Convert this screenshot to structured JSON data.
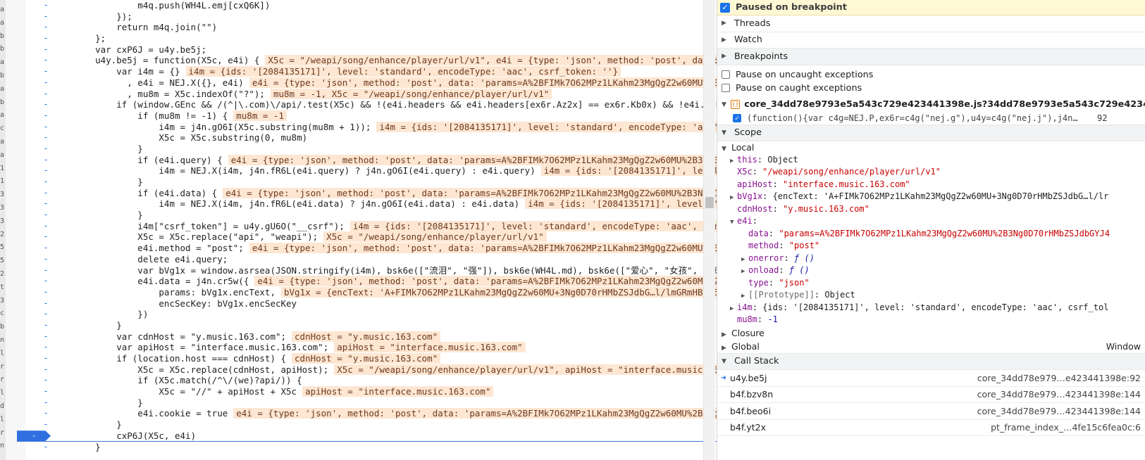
{
  "left_strip_chars": [
    "a",
    "a",
    "b",
    "b",
    "a",
    "b",
    "a",
    "b",
    "a",
    "c",
    "a",
    "a",
    "1",
    "1",
    "3",
    "3",
    "3",
    "2",
    "5",
    "5",
    "2",
    "t",
    "3",
    "c",
    "b",
    "n",
    "l",
    "r",
    "r",
    "l",
    "d",
    "l",
    "r",
    "n"
  ],
  "code_lines": [
    {
      "code": "            m4q.push(WH4L.emj[cxQ6K])",
      "inline": ""
    },
    {
      "code": "        });",
      "inline": ""
    },
    {
      "code": "        return m4q.join(\"\")",
      "inline": ""
    },
    {
      "code": "    };",
      "inline": ""
    },
    {
      "code": "    var cxP6J = u4y.be5j;",
      "inline": ""
    },
    {
      "code": "    u4y.be5j = function(X5c, e4i) {",
      "inline": "X5c = \"/weapi/song/enhance/player/url/v1\", e4i = {type: 'json', method: 'post', data: 'params"
    },
    {
      "code": "        var i4m = {}",
      "inline": "i4m = {ids: '[2084135171]', level: 'standard', encodeType: 'aac', csrf_token: ''}"
    },
    {
      "code": "          , e4i = NEJ.X({}, e4i)",
      "inline": "e4i = {type: 'json', method: 'post', data: 'params=A%2BFIMk7O62MPz1LKahm23MgQgZ2w60MU%2B3Ng0D7…"
    },
    {
      "code": "          , mu8m = X5c.indexOf(\"?\");",
      "inline": "mu8m = -1, X5c = \"/weapi/song/enhance/player/url/v1\""
    },
    {
      "code": "        if (window.GEnc && /(^|\\.com)\\/api/.test(X5c) && !(e4i.headers && e4i.headers[ex6r.Az2x] == ex6r.Kb0x) && !e4i.noEnc) {",
      "inline": ""
    },
    {
      "code": "            if (mu8m != -1) {",
      "inline": "mu8m = -1"
    },
    {
      "code": "                i4m = j4n.gO6I(X5c.substring(mu8m + 1));",
      "inline": "i4m = {ids: '[2084135171]', level: 'standard', encodeType: 'aac', csrf_"
    },
    {
      "code": "                X5c = X5c.substring(0, mu8m)",
      "inline": ""
    },
    {
      "code": "            }",
      "inline": ""
    },
    {
      "code": "            if (e4i.query) {",
      "inline": "e4i = {type: 'json', method: 'post', data: 'params=A%2BFIMk7O62MPz1LKahm23MgQgZ2w60MU%2B3Ng0D7…85d6"
    },
    {
      "code": "                i4m = NEJ.X(i4m, j4n.fR6L(e4i.query) ? j4n.gO6I(e4i.query) : e4i.query)",
      "inline": "i4m = {ids: '[2084135171]', level: 'stan"
    },
    {
      "code": "            }",
      "inline": ""
    },
    {
      "code": "            if (e4i.data) {",
      "inline": "e4i = {type: 'json', method: 'post', data: 'params=A%2BFIMk7O62MPz1LKahm23MgQgZ2w60MU%2B3Ng0D7…85d6a"
    },
    {
      "code": "                i4m = NEJ.X(i4m, j4n.fR6L(e4i.data) ? j4n.gO6I(e4i.data) : e4i.data)",
      "inline": "i4m = {ids: '[2084135171]', level: 'standar"
    },
    {
      "code": "            }",
      "inline": ""
    },
    {
      "code": "            i4m[\"csrf_token\"] = u4y.gU6O(\"__csrf\");",
      "inline": "i4m = {ids: '[2084135171]', level: 'standard', encodeType: 'aac', csrf_token"
    },
    {
      "code": "            X5c = X5c.replace(\"api\", \"weapi\");",
      "inline": "X5c = \"/weapi/song/enhance/player/url/v1\""
    },
    {
      "code": "            e4i.method = \"post\";",
      "inline": "e4i = {type: 'json', method: 'post', data: 'params=A%2BFIMk7O62MPz1LKahm23MgQgZ2w60MU%2B3Ng0D7…"
    },
    {
      "code": "            delete e4i.query;",
      "inline": ""
    },
    {
      "code": "            var bVg1x = window.asrsea(JSON.stringify(i4m), bsk6e([\"流泪\", \"强\"]), bsk6e(WH4L.md), bsk6e([\"爱心\", \"女孩\", \"惊恐\", \"",
      "inline": ""
    },
    {
      "code": "            e4i.data = j4n.cr5w({",
      "inline": "e4i = {type: 'json', method: 'post', data: 'params=A%2BFIMk7O62MPz1LKahm23MgQgZ2w60MU%2B3Ng0D7"
    },
    {
      "code": "                params: bVg1x.encText,",
      "inline": "bVg1x = {encText: 'A+FIMk7O62MPz1LKahm23MgQgZ2w60MU+3Ng0D70rHMbZSJdbG…l/lmGRmHB875iqdjIzZ"
    },
    {
      "code": "                encSecKey: bVg1x.encSecKey",
      "inline": ""
    },
    {
      "code": "            })",
      "inline": ""
    },
    {
      "code": "        }",
      "inline": ""
    },
    {
      "code": "        var cdnHost = \"y.music.163.com\";",
      "inline": "cdnHost = \"y.music.163.com\""
    },
    {
      "code": "        var apiHost = \"interface.music.163.com\";",
      "inline": "apiHost = \"interface.music.163.com\""
    },
    {
      "code": "        if (location.host === cdnHost) {",
      "inline": "cdnHost = \"y.music.163.com\""
    },
    {
      "code": "            X5c = X5c.replace(cdnHost, apiHost);",
      "inline": "X5c = \"/weapi/song/enhance/player/url/v1\", apiHost = \"interface.music.163.com\""
    },
    {
      "code": "            if (X5c.match(/^\\/(we)?api/)) {",
      "inline": ""
    },
    {
      "code": "                X5c = \"//\" + apiHost + X5c",
      "inline": "apiHost = \"interface.music.163.com\""
    },
    {
      "code": "            }",
      "inline": ""
    },
    {
      "code": "            e4i.cookie = true",
      "inline": "e4i = {type: 'json', method: 'post', data: 'params=A%2BFIMk7O62MPz1LKahm23MgQgZ2w60MU%2B3Ng0D7…85c"
    },
    {
      "code": "        }",
      "inline": ""
    },
    {
      "code": "        cxP6J(X5c, e4i)",
      "inline": ""
    },
    {
      "code": "    }",
      "inline": ""
    }
  ],
  "gutter_dash": "-",
  "panel": {
    "paused_text": "Paused on breakpoint",
    "threads": "Threads",
    "watch": "Watch",
    "breakpoints": "Breakpoints",
    "pause_uncaught": "Pause on uncaught exceptions",
    "pause_caught": "Pause on caught exceptions",
    "bp_file": "core_34dd78e9793e5a543c729e423441398e.js?34dd78e9793e5a543c729e423441…",
    "bp_snippet": "(function(){var c4g=NEJ.P,ex6r=c4g(\"nej.g\"),u4y=c4g(\"nej.j\"),j4n…",
    "bp_line": "92",
    "scope": "Scope",
    "local": "Local",
    "scope_items": [
      {
        "indent": 1,
        "arrow": "▶",
        "key": "this",
        "sep": ": ",
        "val": "Object",
        "vtype": "plain"
      },
      {
        "indent": 1,
        "arrow": "",
        "key": "X5c",
        "sep": ": ",
        "val": "\"/weapi/song/enhance/player/url/v1\"",
        "vtype": "str"
      },
      {
        "indent": 1,
        "arrow": "",
        "key": "apiHost",
        "sep": ": ",
        "val": "\"interface.music.163.com\"",
        "vtype": "str"
      },
      {
        "indent": 1,
        "arrow": "▶",
        "key": "bVg1x",
        "sep": ": ",
        "val": "{encText: 'A+FIMk7O62MPz1LKahm23MgQgZ2w60MU+3Ng0D70rHMbZSJdbG…l/lr",
        "vtype": "mixed"
      },
      {
        "indent": 1,
        "arrow": "",
        "key": "cdnHost",
        "sep": ": ",
        "val": "\"y.music.163.com\"",
        "vtype": "str"
      },
      {
        "indent": 1,
        "arrow": "▼",
        "key": "e4i",
        "sep": ":",
        "val": "",
        "vtype": "plain"
      },
      {
        "indent": 2,
        "arrow": "",
        "key": "data",
        "sep": ": ",
        "val": "\"params=A%2BFIMk7O62MPz1LKahm23MgQgZ2w60MU%2B3Ng0D70rHMbZSJdbGYJ4",
        "vtype": "str"
      },
      {
        "indent": 2,
        "arrow": "",
        "key": "method",
        "sep": ": ",
        "val": "\"post\"",
        "vtype": "str"
      },
      {
        "indent": 2,
        "arrow": "▶",
        "key": "onerror",
        "sep": ": ",
        "val": "ƒ ()",
        "vtype": "fn"
      },
      {
        "indent": 2,
        "arrow": "▶",
        "key": "onload",
        "sep": ": ",
        "val": "ƒ ()",
        "vtype": "fn"
      },
      {
        "indent": 2,
        "arrow": "",
        "key": "type",
        "sep": ": ",
        "val": "\"json\"",
        "vtype": "str"
      },
      {
        "indent": 2,
        "arrow": "▶",
        "key": "[[Prototype]]",
        "sep": ": ",
        "val": "Object",
        "vtype": "proto"
      },
      {
        "indent": 1,
        "arrow": "▶",
        "key": "i4m",
        "sep": ": ",
        "val": "{ids: '[2084135171]', level: 'standard', encodeType: 'aac', csrf_tol",
        "vtype": "mixed"
      },
      {
        "indent": 1,
        "arrow": "",
        "key": "mu8m",
        "sep": ": ",
        "val": "-1",
        "vtype": "num"
      }
    ],
    "closure": "Closure",
    "global": "Global",
    "global_val": "Window",
    "call_stack": "Call Stack",
    "frames": [
      {
        "name": "u4y.be5j",
        "loc": "core_34dd78e979…e423441398e:92",
        "current": true
      },
      {
        "name": "b4f.bzv8n",
        "loc": "core_34dd78e979…423441398e:144",
        "current": false
      },
      {
        "name": "b4f.beo6i",
        "loc": "core_34dd78e979…423441398e:144",
        "current": false
      },
      {
        "name": "b4f.yt2x",
        "loc": "pt_frame_index_…4fe15c6fea0c:6",
        "current": false
      }
    ]
  }
}
